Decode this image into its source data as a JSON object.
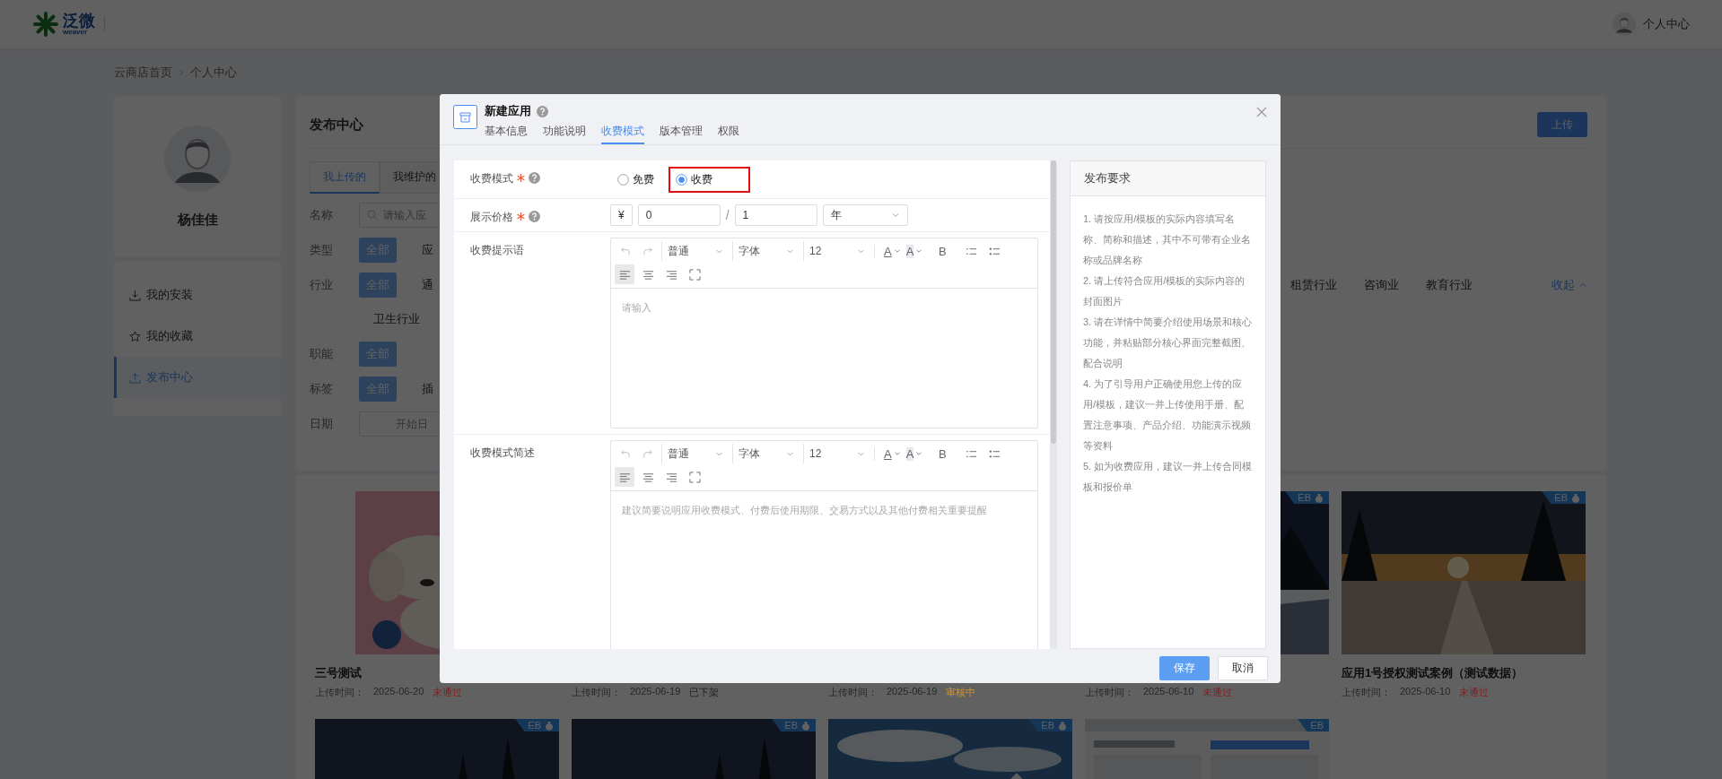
{
  "header": {
    "logo": {
      "name": "泛微",
      "subtitle": "weaver"
    },
    "user": "个人中心"
  },
  "breadcrumb": [
    "云商店首页",
    "个人中心"
  ],
  "profile": {
    "name": "杨佳佳"
  },
  "menu": [
    {
      "label": "我的安装",
      "kind": "install",
      "selected": false
    },
    {
      "label": "我的收藏",
      "kind": "favorite",
      "selected": false
    },
    {
      "label": "发布中心",
      "kind": "publish",
      "selected": true
    }
  ],
  "publish": {
    "title": "发布中心",
    "upload": "上传",
    "tabs": [
      {
        "label": "我上传的",
        "selected": true
      },
      {
        "label": "我维护的",
        "selected": false
      }
    ],
    "filters": [
      {
        "label": "名称",
        "kind": "search",
        "placeholder": "请输入应"
      },
      {
        "label": "类型",
        "kind": "chips",
        "options": [
          {
            "label": "全部",
            "selected": true
          },
          {
            "label": "应",
            "selected": false
          }
        ]
      },
      {
        "label": "行业",
        "kind": "chips",
        "options": [
          {
            "label": "全部",
            "selected": true
          },
          {
            "label": "通",
            "selected": false
          }
        ],
        "more_options": [
          {
            "label": "租赁行业",
            "selected": false
          },
          {
            "label": "咨询业",
            "selected": false
          },
          {
            "label": "教育行业",
            "selected": false
          }
        ],
        "second_line": [
          {
            "label": "卫生行业",
            "selected": false
          }
        ],
        "toggle": "收起"
      },
      {
        "label": "职能",
        "kind": "chips",
        "options": [
          {
            "label": "全部",
            "selected": true
          }
        ]
      },
      {
        "label": "标签",
        "kind": "chips",
        "options": [
          {
            "label": "全部",
            "selected": true
          },
          {
            "label": "插",
            "selected": false
          }
        ]
      },
      {
        "label": "日期",
        "kind": "date",
        "placeholder": "开始日"
      }
    ]
  },
  "cards": [
    {
      "title": "三号测试",
      "time_label": "上传时间：",
      "date": "2025-06-20",
      "status": "未通过",
      "color": "#8a1d1d"
    },
    {
      "time_label": "上传时间：",
      "date": "2025-06-19",
      "status": "已下架",
      "color": "#1e1e1e"
    },
    {
      "time_label": "上传时间：",
      "date": "2025-06-19",
      "status": "审核中",
      "color": "#d8962a"
    },
    {
      "time_label": "上传时间：",
      "date": "2025-06-10",
      "status": "未通过",
      "color": "#8a1d1d",
      "badge": {
        "text": "EB",
        "paid": true
      }
    },
    {
      "title": "应用1号授权测试案例（测试数据）",
      "time_label": "上传时间：",
      "date": "2025-06-10",
      "status": "未通过",
      "color": "#8a1d1d",
      "badge": {
        "text": "EB",
        "paid": true
      }
    },
    {
      "badge": {
        "text": "EB",
        "paid": true
      }
    },
    {
      "badge": {
        "text": "EB",
        "paid": true
      }
    },
    {
      "badge": {
        "text": "EB",
        "paid": true
      }
    },
    {
      "badge": {
        "text": "EB"
      }
    }
  ],
  "dialog": {
    "title": "新建应用",
    "help": true,
    "tabs": [
      {
        "label": "基本信息",
        "selected": false
      },
      {
        "label": "功能说明",
        "selected": false
      },
      {
        "label": "收费模式",
        "selected": true
      },
      {
        "label": "版本管理",
        "selected": false
      },
      {
        "label": "权限",
        "selected": false
      }
    ],
    "rows": [
      {
        "kind": "radio",
        "label": "收费模式",
        "required": true,
        "help": true,
        "options": [
          {
            "label": "免费",
            "selected": false,
            "highlighted": false
          },
          {
            "label": "收费",
            "selected": true,
            "highlighted": true
          }
        ]
      },
      {
        "kind": "price",
        "label": "展示价格",
        "required": true,
        "help": true,
        "currency": "¥",
        "price": "0",
        "separator": "/",
        "quantity": "1",
        "unit": "年"
      },
      {
        "kind": "editor",
        "label": "收费提示语",
        "placeholder": "请输入",
        "toolbar": [
          {
            "kind": "undo"
          },
          {
            "kind": "redo"
          },
          {
            "kind": "select",
            "label": "普通"
          },
          {
            "kind": "select",
            "label": "字体"
          },
          {
            "kind": "select",
            "label": "12"
          },
          {
            "kind": "fontcolor",
            "label": "A"
          },
          {
            "kind": "highlight",
            "label": "A"
          },
          {
            "kind": "bold",
            "label": "B"
          },
          {
            "kind": "olist"
          },
          {
            "kind": "ulist"
          },
          {
            "kind": "alignleft",
            "selected": true
          },
          {
            "kind": "aligncenter",
            "selected": false
          },
          {
            "kind": "alignright",
            "selected": false
          },
          {
            "kind": "fullscreen"
          }
        ]
      },
      {
        "kind": "editor",
        "label": "收费模式简述",
        "placeholder": "建议简要说明应用收费模式、付费后使用期限、交易方式以及其他付费相关重要提醒",
        "toolbar": [
          {
            "kind": "undo"
          },
          {
            "kind": "redo"
          },
          {
            "kind": "select",
            "label": "普通"
          },
          {
            "kind": "select",
            "label": "字体"
          },
          {
            "kind": "select",
            "label": "12"
          },
          {
            "kind": "fontcolor",
            "label": "A"
          },
          {
            "kind": "highlight",
            "label": "A"
          },
          {
            "kind": "bold",
            "label": "B"
          },
          {
            "kind": "olist"
          },
          {
            "kind": "ulist"
          },
          {
            "kind": "alignleft",
            "selected": true
          },
          {
            "kind": "aligncenter",
            "selected": false
          },
          {
            "kind": "alignright",
            "selected": false
          },
          {
            "kind": "fullscreen"
          }
        ]
      }
    ],
    "requirements": {
      "title": "发布要求",
      "items": [
        "1. 请按应用/模板的实际内容填写名称、简称和描述，其中不可带有企业名称或品牌名称",
        "2. 请上传符合应用/模板的实际内容的封面图片",
        "3. 请在详情中简要介绍使用场景和核心功能，并粘贴部分核心界面完整截图、配合说明",
        "4. 为了引导用户正确使用您上传的应用/模板，建议一并上传使用手册、配置注意事项、产品介绍、功能演示视频等资料",
        "5. 如为收费应用，建议一并上传合同模板和报价单"
      ]
    },
    "buttons": [
      {
        "label": "保存",
        "kind": "primary"
      },
      {
        "label": "取消",
        "kind": "default"
      }
    ]
  }
}
